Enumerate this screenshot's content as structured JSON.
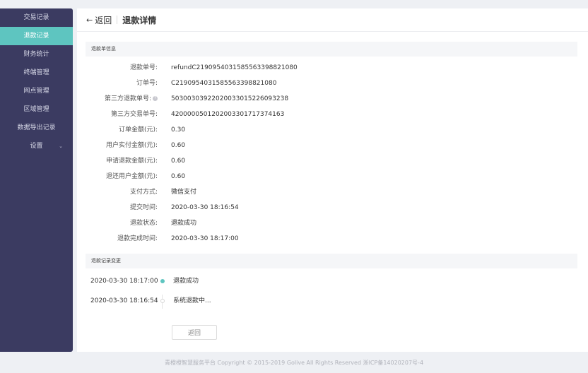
{
  "sidebar": {
    "items": [
      {
        "label": "交易记录",
        "active": false
      },
      {
        "label": "退款记录",
        "active": true
      },
      {
        "label": "财务统计",
        "active": false
      },
      {
        "label": "终端管理",
        "active": false
      },
      {
        "label": "网点管理",
        "active": false
      },
      {
        "label": "区域管理",
        "active": false
      },
      {
        "label": "数据导出记录",
        "active": false
      },
      {
        "label": "设置",
        "active": false,
        "has_chevron": true
      }
    ]
  },
  "header": {
    "back_label": "返回",
    "title": "退款详情"
  },
  "refund_info": {
    "section_title": "退款单信息",
    "fields": [
      {
        "label": "退款单号:",
        "value": "refundC2190954031585563398821080"
      },
      {
        "label": "订单号:",
        "value": "C2190954031585563398821080"
      },
      {
        "label": "第三方退款单号:",
        "value": "50300303922020033015226093238",
        "has_help": true
      },
      {
        "label": "第三方交易单号:",
        "value": "4200000501202003301717374163"
      },
      {
        "label": "订单金额(元):",
        "value": "0.30"
      },
      {
        "label": "用户实付金额(元):",
        "value": "0.60"
      },
      {
        "label": "申请退款金额(元):",
        "value": "0.60"
      },
      {
        "label": "退还用户金额(元):",
        "value": "0.60"
      },
      {
        "label": "支付方式:",
        "value": "微信支付"
      },
      {
        "label": "提交时间:",
        "value": "2020-03-30 18:16:54"
      },
      {
        "label": "退款状态:",
        "value": "退款成功"
      },
      {
        "label": "退款完成时间:",
        "value": "2020-03-30 18:17:00"
      }
    ]
  },
  "refund_log": {
    "section_title": "退款记录变更",
    "entries": [
      {
        "time": "2020-03-30 18:17:00",
        "event": "退款成功",
        "dot": "filled"
      },
      {
        "time": "2020-03-30 18:16:54",
        "event": "系统退款中...",
        "dot": "hollow"
      }
    ]
  },
  "actions": {
    "back_button": "返回"
  },
  "footer": {
    "text": "青橙橙智慧服务平台 Copyright © 2015-2019 Golive All Rights Reserved 浙ICP备14020207号-4"
  },
  "colors": {
    "sidebar_bg": "#3b3b61",
    "accent": "#5ec5c0"
  }
}
